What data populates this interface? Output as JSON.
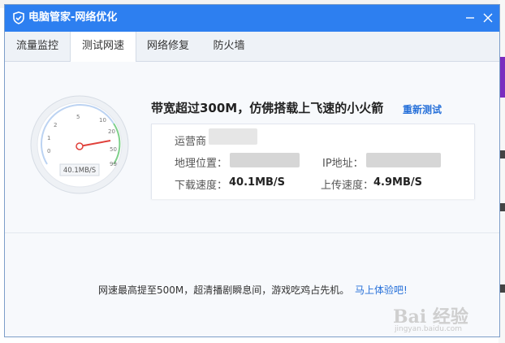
{
  "window": {
    "title": "电脑管家-网络优化"
  },
  "tabs": [
    {
      "label": "流量监控",
      "active": false
    },
    {
      "label": "测试网速",
      "active": true
    },
    {
      "label": "网络修复",
      "active": false
    },
    {
      "label": "防火墙",
      "active": false
    }
  ],
  "gauge": {
    "ticks": [
      "0",
      "1",
      "2",
      "5",
      "10",
      "20",
      "50",
      "99"
    ],
    "readout": "40.1MB/S",
    "needle_value_label": "40.1MB/S"
  },
  "result": {
    "headline": "带宽超过300M，仿佛搭载上飞速的小火箭",
    "retest_label": "重新测试",
    "isp_label": "运营商",
    "location_label": "地理位置：",
    "ip_label": "IP地址：",
    "download_label": "下载速度：",
    "download_value": "40.1MB/S",
    "upload_label": "上传速度：",
    "upload_value": "4.9MB/S"
  },
  "promo": {
    "text": "网速最高提至500M，超清播剧瞬息间，游戏吃鸡占先机。",
    "link_label": "马上体验吧!"
  },
  "watermark": {
    "text": "Bai 经验",
    "sub": "jingyan.baidu.com"
  },
  "colors": {
    "titlebar": "#2d7ff0",
    "link": "#2670d9",
    "accent_purple": "#7b2cbf"
  }
}
